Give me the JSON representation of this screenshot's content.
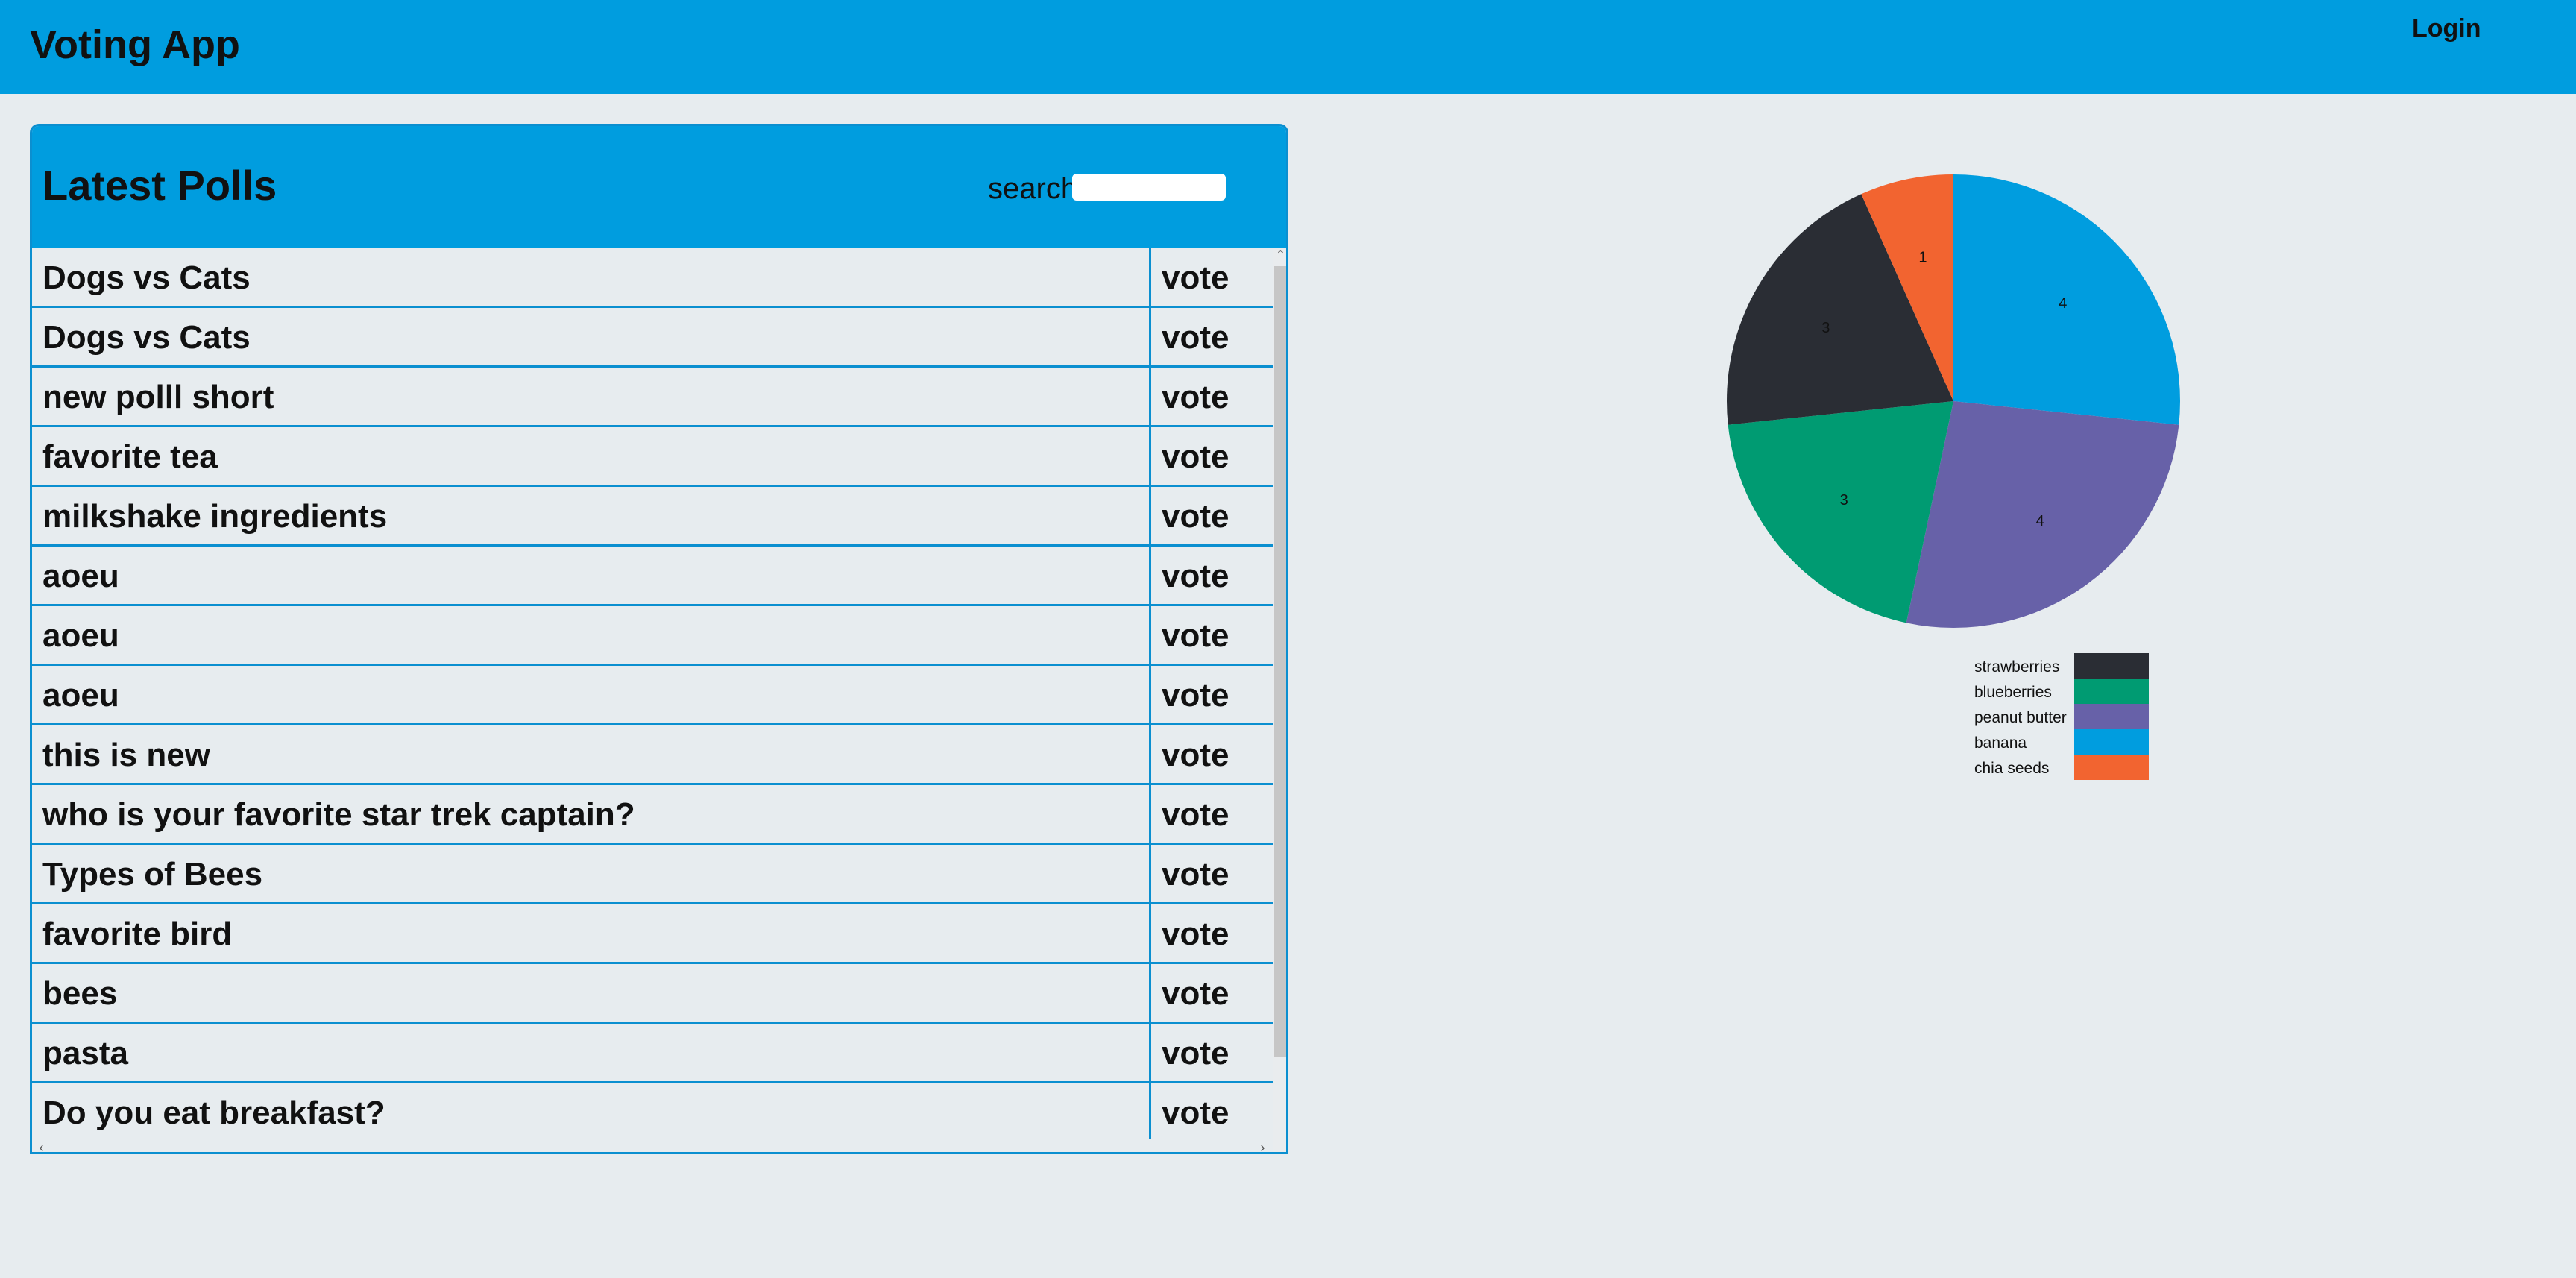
{
  "navbar": {
    "brand": "Voting App",
    "login_label": "Login"
  },
  "polls_panel": {
    "title": "Latest Polls",
    "search_label": "search",
    "search_value": "",
    "vote_label": "vote",
    "polls": [
      "Dogs vs Cats",
      "Dogs vs Cats",
      "new polll short",
      "favorite tea",
      "milkshake ingredients",
      "aoeu",
      "aoeu",
      "aoeu",
      "this is new",
      "who is your favorite star trek captain?",
      "Types of Bees",
      "favorite bird",
      "bees",
      "pasta",
      "Do you eat breakfast?"
    ]
  },
  "icons": {
    "scroll_up": "chevron-up-icon",
    "scroll_down": "chevron-down-icon",
    "scroll_left": "chevron-left-icon",
    "scroll_right": "chevron-right-icon"
  },
  "colors": {
    "brand_blue": "#009ddf",
    "border_blue": "#0b8fd0",
    "background": "#e7ecef"
  },
  "chart_data": {
    "type": "pie",
    "slices": [
      {
        "label": "banana",
        "value": 4,
        "color": "#009ddf"
      },
      {
        "label": "peanut butter",
        "value": 4,
        "color": "#6761a8"
      },
      {
        "label": "blueberries",
        "value": 3,
        "color": "#009b72"
      },
      {
        "label": "strawberries",
        "value": 3,
        "color": "#2a2d34"
      },
      {
        "label": "chia seeds",
        "value": 1,
        "color": "#f26430"
      }
    ],
    "legend_order": [
      "strawberries",
      "blueberries",
      "peanut butter",
      "banana",
      "chia seeds"
    ],
    "legend_placement": "bottom",
    "show_values": true
  }
}
